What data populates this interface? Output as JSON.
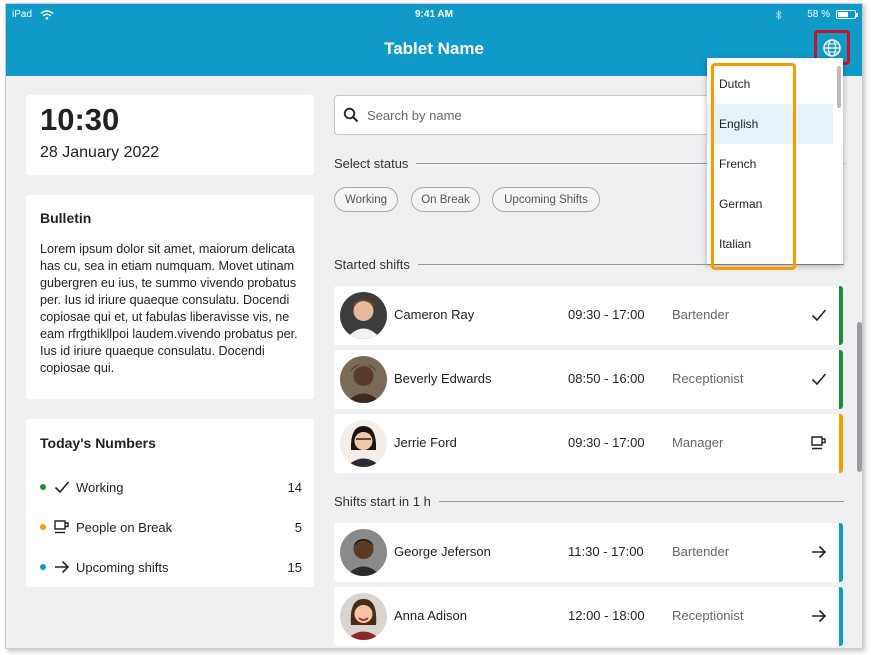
{
  "status_bar": {
    "device": "iPad",
    "time": "9:41 AM",
    "battery": "58 %"
  },
  "header": {
    "title": "Tablet Name"
  },
  "clock": {
    "time": "10:30",
    "date": "28 January 2022"
  },
  "bulletin": {
    "title": "Bulletin",
    "text": "Lorem ipsum dolor sit amet, maiorum delicata has cu, sea in etiam numquam. Movet utinam gubergren eu ius, te summo vivendo probatus per. Ius id iriure quaeque consulatu. Docendi copiosae qui et, ut fabulas liberavisse vis, ne eam rfrgthikllpoi laudem.vivendo probatus per. Ius id iriure quaeque consulatu. Docendi copiosae qui."
  },
  "numbers": {
    "title": "Today's Numbers",
    "items": [
      {
        "label": "Working",
        "count": "14",
        "dot_color": "#1e8e3e"
      },
      {
        "label": "People on Break",
        "count": "5",
        "dot_color": "#f59c00"
      },
      {
        "label": "Upcoming shifts",
        "count": "15",
        "dot_color": "#0f9ac8"
      }
    ]
  },
  "search": {
    "placeholder": "Search by name",
    "value": ""
  },
  "status_filter": {
    "label": "Select status",
    "chips": [
      "Working",
      "On Break",
      "Upcoming Shifts"
    ]
  },
  "started": {
    "label": "Started shifts",
    "rows": [
      {
        "name": "Cameron Ray",
        "time": "09:30 - 17:00",
        "role": "Bartender",
        "status": "check",
        "color": "#1e8e3e"
      },
      {
        "name": "Beverly Edwards",
        "time": "08:50 - 16:00",
        "role": "Receptionist",
        "status": "check",
        "color": "#1e8e3e"
      },
      {
        "name": "Jerrie Ford",
        "time": "09:30 - 17:00",
        "role": "Manager",
        "status": "coffee",
        "color": "#f59c00"
      }
    ]
  },
  "upcoming": {
    "label": "Shifts start in 1 h",
    "rows": [
      {
        "name": "George Jeferson",
        "time": "11:30 - 17:00",
        "role": "Bartender",
        "status": "arrow",
        "color": "#0f9ac8"
      },
      {
        "name": "Anna Adison",
        "time": "12:00 - 18:00",
        "role": "Receptionist",
        "status": "arrow",
        "color": "#0f9ac8"
      }
    ]
  },
  "language_menu": {
    "options": [
      "Dutch",
      "English",
      "French",
      "German",
      "Italian"
    ],
    "selected": "English"
  },
  "icons": {
    "language": "globe-icon",
    "search": "search-icon",
    "working": "check-icon",
    "break": "coffee-icon",
    "upcoming": "arrow-right-icon"
  }
}
